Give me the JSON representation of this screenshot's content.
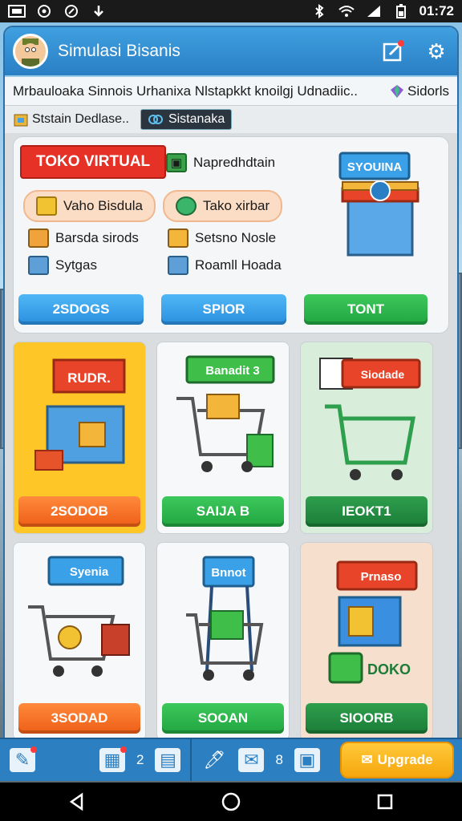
{
  "status_bar": {
    "time": "01:72",
    "left_icons": [
      "sim-icon",
      "whatsapp-icon",
      "location-icon",
      "download-icon"
    ],
    "right_icons": [
      "bluetooth-icon",
      "wifi-icon",
      "signal-icon",
      "battery-icon"
    ]
  },
  "app_bar": {
    "title": "Simulasi Bisanis",
    "avatar": "avatar-icon",
    "actions": [
      "edit-note-icon",
      "gear-icon"
    ]
  },
  "ticker": {
    "headline": "Mrbauloaka Sinnois Urhanixa Nlstapkkt knoilgj Udnadiic..",
    "gem_label": "Sidorls",
    "chip1_label": "Ststain Dedlase..",
    "chip2_label": "Sistanaka"
  },
  "featured_panel": {
    "title": "TOKO VIRTUAL",
    "items": [
      {
        "label": "Napredhdtain",
        "icon": "crate-icon"
      },
      {
        "label": "Vaho Bisdula",
        "icon": "box-icon",
        "style": "pill"
      },
      {
        "label": "Tako xirbar",
        "icon": "globe-icon",
        "style": "pill"
      },
      {
        "label": "Barsda sirods",
        "icon": "package-icon"
      },
      {
        "label": "Setsno Nosle",
        "icon": "package-icon"
      },
      {
        "label": "Sytgas",
        "icon": "package-icon"
      },
      {
        "label": "Roamll Hoada",
        "icon": "package-icon"
      }
    ],
    "store_sign": "SYOUINA",
    "buttons": [
      {
        "label": "2SDOGS",
        "color": "blue"
      },
      {
        "label": "SPIOR",
        "color": "blue"
      },
      {
        "label": "TONT",
        "color": "green"
      }
    ]
  },
  "cards": [
    {
      "sign": "RUDR.",
      "button": "2SODOB",
      "bg": "#ffc627",
      "btn_color": "orange"
    },
    {
      "sign": "Banadit 3",
      "button": "SAIJA B",
      "bg": "#f7f8f9",
      "btn_color": "green"
    },
    {
      "sign": "Siodade",
      "button": "IEOKT1",
      "bg": "#d9eddb",
      "btn_color": "dgreen"
    },
    {
      "sign": "Syenia",
      "button": "3SODAD",
      "bg": "#f7f8f9",
      "btn_color": "orange"
    },
    {
      "sign": "Bnnot",
      "button": "SOOAN",
      "bg": "#f7f8f9",
      "btn_color": "green"
    },
    {
      "sign": "Prnaso",
      "extra_label": "DOKO",
      "button": "SIOORB",
      "bg": "#f6dfcc",
      "btn_color": "dgreen"
    }
  ],
  "bottom_bar": {
    "badge_count_1": "2",
    "badge_count_2": "8",
    "upgrade_label": "Upgrade"
  },
  "nav_bar": [
    "back-icon",
    "home-icon",
    "recents-icon"
  ]
}
